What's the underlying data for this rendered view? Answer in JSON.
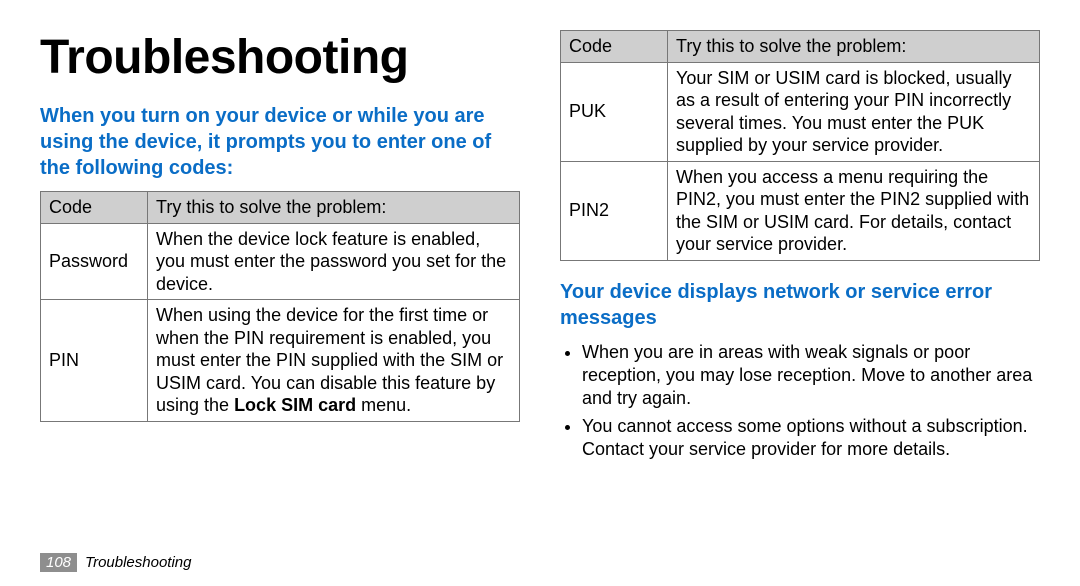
{
  "page_title": "Troubleshooting",
  "left": {
    "heading": "When you turn on your device or while you are using the device, it prompts you to enter one of the following codes:",
    "header_code": "Code",
    "header_try": "Try this to solve the problem:",
    "rows": [
      {
        "code": "Password",
        "text": "When the device lock feature is enabled, you must enter the password you set for the device."
      },
      {
        "code": "PIN",
        "text_pre": "When using the device for the first time or when the PIN requirement is enabled, you must enter the PIN supplied with the SIM or USIM card. You can disable this feature by using the ",
        "bold": "Lock SIM card",
        "text_post": " menu."
      }
    ]
  },
  "right": {
    "header_code": "Code",
    "header_try": "Try this to solve the problem:",
    "rows": [
      {
        "code": "PUK",
        "text": "Your SIM or USIM card is blocked, usually as a result of entering your PIN incorrectly several times. You must enter the PUK supplied by your service provider."
      },
      {
        "code": "PIN2",
        "text": "When you access a menu requiring the PIN2, you must enter the PIN2 supplied with the SIM or USIM card. For details, contact your service provider."
      }
    ],
    "section_heading": "Your device displays network or service error messages",
    "bullets": [
      "When you are in areas with weak signals or poor reception, you may lose reception. Move to another area and try again.",
      "You cannot access some options without a subscription. Contact your service provider for more details."
    ]
  },
  "footer": {
    "page_number": "108",
    "section_name": "Troubleshooting"
  }
}
